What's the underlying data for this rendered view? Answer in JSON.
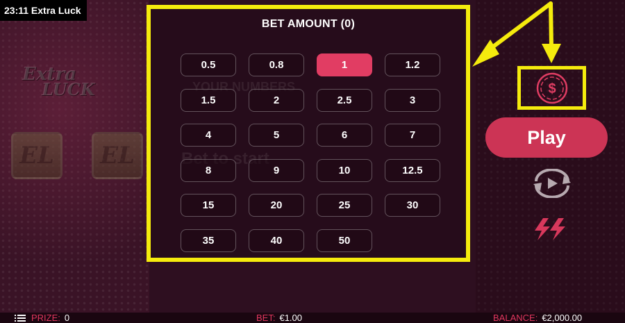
{
  "title_bar": {
    "text": "23:11 Extra Luck"
  },
  "logo": {
    "line1": "Extra",
    "line2": "LUCK"
  },
  "background": {
    "tile_letter": "EL",
    "ghost_numbers": "YOUR NUMBERS",
    "ghost_start": "Bet to start"
  },
  "bet_panel": {
    "title": "BET AMOUNT (0)",
    "options": [
      "0.5",
      "0.8",
      "1",
      "1.2",
      "1.5",
      "2",
      "2.5",
      "3",
      "4",
      "5",
      "6",
      "7",
      "8",
      "9",
      "10",
      "12.5",
      "15",
      "20",
      "25",
      "30",
      "35",
      "40",
      "50"
    ],
    "selected": "1"
  },
  "controls": {
    "play_label": "Play",
    "bet_icon": "dollar-coin-icon",
    "autoplay_icon": "autoplay-icon",
    "turbo_icon": "turbo-lightning-icon"
  },
  "bottom_bar": {
    "prize_label": "PRIZE:",
    "prize_value": "0",
    "bet_label": "BET:",
    "bet_value": "€1.00",
    "balance_label": "BALANCE:",
    "balance_value": "€2,000.00"
  },
  "colors": {
    "accent": "#e13d63",
    "highlight": "#f5eb0d",
    "background": "#2a0f1e"
  }
}
